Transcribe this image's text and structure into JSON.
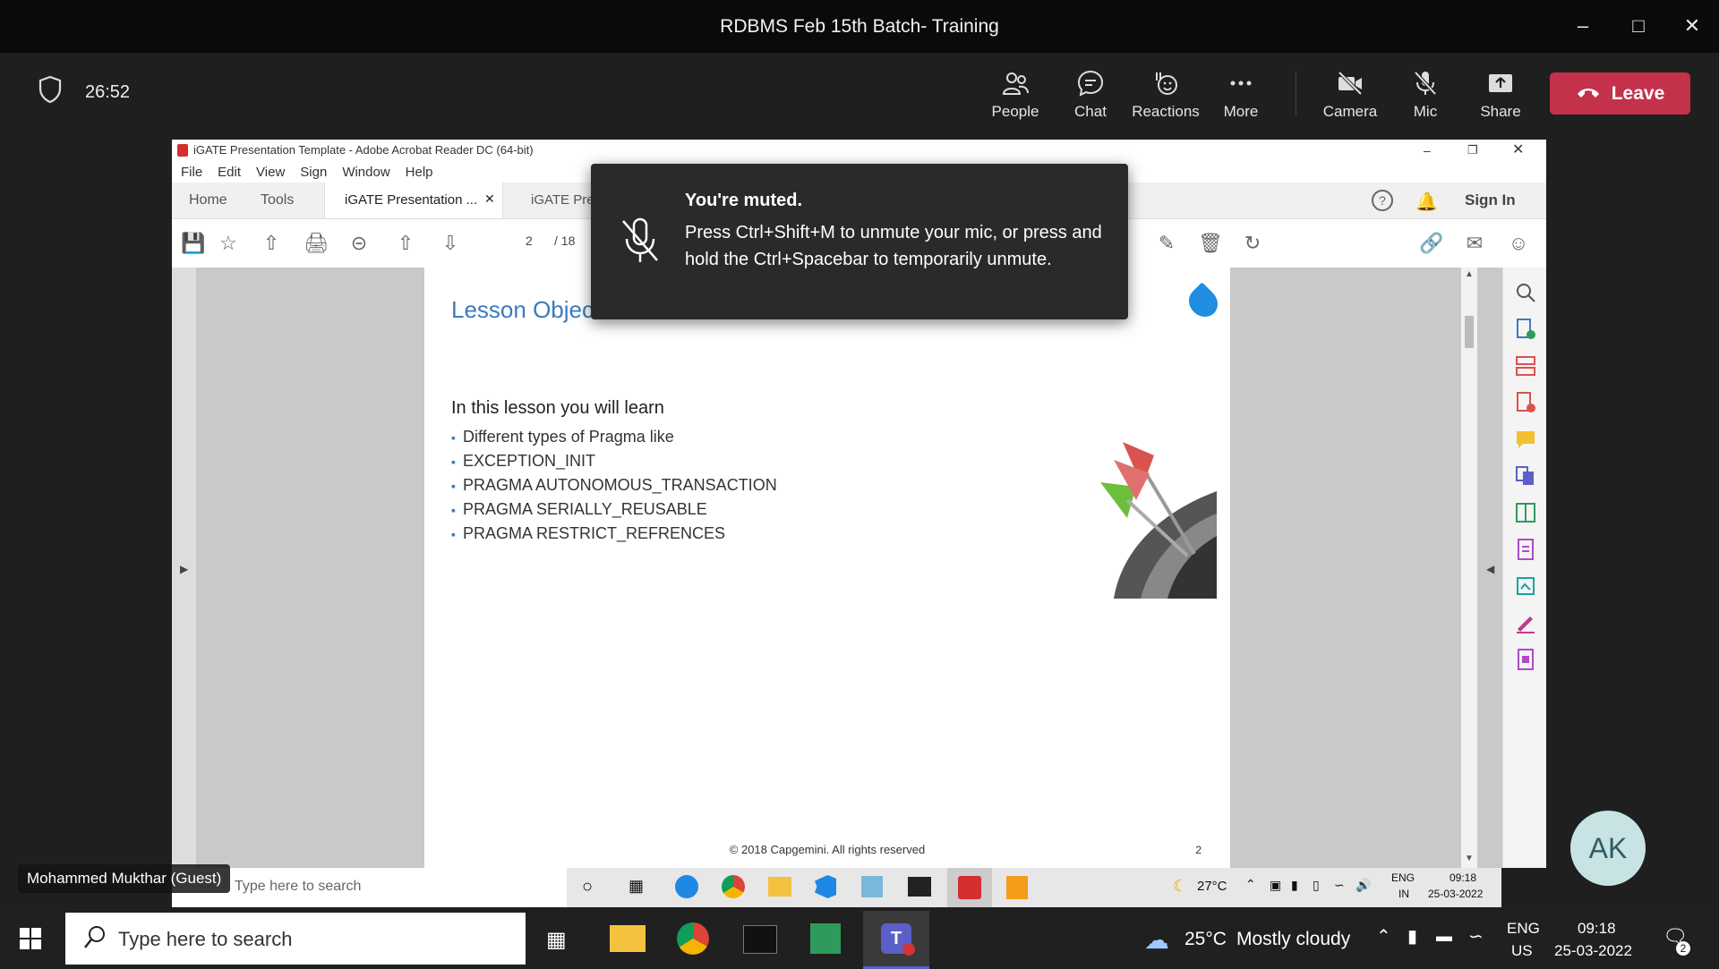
{
  "window": {
    "title": "RDBMS Feb 15th Batch- Training"
  },
  "meeting": {
    "timer": "26:52",
    "buttons": [
      {
        "label": "People",
        "icon": "people-icon"
      },
      {
        "label": "Chat",
        "icon": "chat-icon"
      },
      {
        "label": "Reactions",
        "icon": "reactions-icon"
      },
      {
        "label": "More",
        "icon": "more-icon"
      },
      {
        "label": "Camera",
        "icon": "camera-off-icon"
      },
      {
        "label": "Mic",
        "icon": "mic-off-icon"
      },
      {
        "label": "Share",
        "icon": "share-icon"
      }
    ],
    "leave_label": "Leave",
    "participant_name": "Mohammed Mukthar (Guest)",
    "avatar_initials": "AK"
  },
  "toast": {
    "title": "You're muted.",
    "message": "Press Ctrl+Shift+M to unmute your mic, or press and hold the Ctrl+Spacebar to temporarily unmute."
  },
  "acrobat": {
    "title": "iGATE Presentation Template - Adobe Acrobat Reader DC (64-bit)",
    "menu": [
      "File",
      "Edit",
      "View",
      "Sign",
      "Window",
      "Help"
    ],
    "nav": {
      "home": "Home",
      "tools": "Tools"
    },
    "tabs": [
      "iGATE Presentation ...",
      "iGATE Pre..."
    ],
    "sign_in": "Sign In",
    "page_current": "2",
    "page_total": "/ 18"
  },
  "slide": {
    "title": "Lesson Objectives",
    "intro": "In this lesson you will learn",
    "items": [
      "Different types of Pragma like",
      "EXCEPTION_INIT",
      "PRAGMA AUTONOMOUS_TRANSACTION",
      "PRAGMA SERIALLY_REUSABLE",
      "PRAGMA RESTRICT_REFRENCES"
    ],
    "footer": "© 2018 Capgemini. All rights reserved",
    "page_number": "2"
  },
  "inner_taskbar": {
    "search_placeholder": "Type here to search",
    "weather": "27°C",
    "lang_top": "ENG",
    "lang_bottom": "IN",
    "time": "09:18",
    "date": "25-03-2022"
  },
  "taskbar": {
    "search_placeholder": "Type here to search",
    "weather": "25°C",
    "weather_desc": "Mostly cloudy",
    "lang_top": "ENG",
    "lang_bottom": "US",
    "time": "09:18",
    "date": "25-03-2022",
    "notification_count": "2"
  },
  "colors": {
    "leave": "#c4314b",
    "accent_blue": "#3b7bbf",
    "teams_purple": "#5b5fc7"
  }
}
